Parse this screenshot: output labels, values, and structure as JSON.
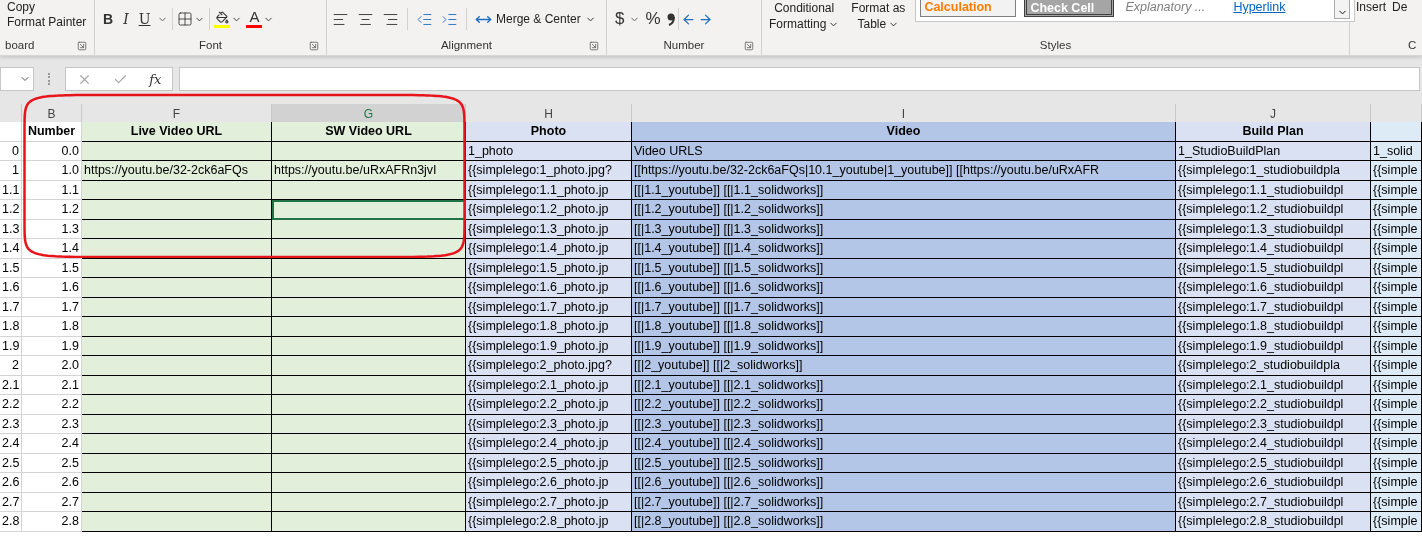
{
  "ribbon": {
    "clipboard": {
      "label": "board",
      "buttons": [
        "Copy",
        "Format Painter"
      ]
    },
    "font": {
      "label": "Font",
      "buttons": [
        {
          "kind": "bold",
          "text": "B"
        },
        {
          "kind": "italic",
          "text": "I"
        },
        {
          "kind": "underline",
          "text": "U"
        }
      ],
      "color_letter": "A"
    },
    "alignment": {
      "label": "Alignment",
      "merge_button": "Merge & Center"
    },
    "number": {
      "label": "Number",
      "symbols": [
        "$",
        "%"
      ]
    },
    "styles": {
      "label": "Styles",
      "buttons": [
        [
          "Conditional",
          "Formatting"
        ],
        [
          "Format as",
          "Table"
        ]
      ],
      "gallery": [
        {
          "kind": "calculation",
          "label": "Calculation"
        },
        {
          "kind": "check",
          "label": "Check Cell"
        },
        {
          "kind": "explanatory",
          "label": "Explanatory ..."
        },
        {
          "kind": "hyperlink",
          "label": "Hyperlink"
        }
      ]
    },
    "cells": {
      "label": "C",
      "buttons": [
        "Insert",
        "De"
      ]
    }
  },
  "formula_bar": {
    "fx": "fx"
  },
  "sheet": {
    "columns": [
      {
        "kind": "index",
        "color": "#ffffff",
        "selected": false
      },
      {
        "kind": "number",
        "letter": "B",
        "header": "Number",
        "color": "#ffffff",
        "selected": false
      },
      {
        "kind": "text",
        "letter": "F",
        "header": "Live Video URL",
        "color": "#e2efda",
        "selected": false
      },
      {
        "kind": "text",
        "letter": "G",
        "header": "SW Video URL",
        "color": "#e2efda",
        "selected": true
      },
      {
        "kind": "text",
        "letter": "H",
        "header": "Photo",
        "color": "#d9e1f2",
        "selected": false
      },
      {
        "kind": "text",
        "letter": "I",
        "header": "Video",
        "color": "#b4c6e7",
        "selected": false
      },
      {
        "kind": "text",
        "letter": "J",
        "header": "Build Plan",
        "color": "#d9e1f2",
        "selected": false
      },
      {
        "kind": "text",
        "color": "#ddebf7",
        "selected": false
      }
    ],
    "rows": [
      {
        "selected": false,
        "cells": [
          "0",
          "0.0",
          "",
          "",
          "1_photo",
          "Video URLS",
          "1_StudioBuildPlan",
          "1_solid"
        ]
      },
      {
        "selected": false,
        "cells": [
          "1",
          "1.0",
          "https://youtu.be/32-2ck6aFQs",
          "https://youtu.be/uRxAFRn3jvI",
          "{{simplelego:1_photo.jpg?",
          "[[https://youtu.be/32-2ck6aFQs|10.1_youtube|1_youtube]] [[https://youtu.be/uRxAFR",
          "{{simplelego:1_studiobuildpla",
          "{{simple"
        ]
      },
      {
        "selected": false,
        "cells": [
          "1.1",
          "1.1",
          "",
          "",
          "{{simplelego:1.1_photo.jp",
          "[[|1.1_youtube]] [[|1.1_solidworks]]",
          "{{simplelego:1.1_studiobuildpl",
          "{{simple"
        ]
      },
      {
        "selected": true,
        "cells": [
          "1.2",
          "1.2",
          "",
          "",
          "{{simplelego:1.2_photo.jp",
          "[[|1.2_youtube]] [[|1.2_solidworks]]",
          "{{simplelego:1.2_studiobuildpl",
          "{{simple"
        ]
      },
      {
        "selected": false,
        "cells": [
          "1.3",
          "1.3",
          "",
          "",
          "{{simplelego:1.3_photo.jp",
          "[[|1.3_youtube]] [[|1.3_solidworks]]",
          "{{simplelego:1.3_studiobuildpl",
          "{{simple"
        ]
      },
      {
        "selected": false,
        "cells": [
          "1.4",
          "1.4",
          "",
          "",
          "{{simplelego:1.4_photo.jp",
          "[[|1.4_youtube]] [[|1.4_solidworks]]",
          "{{simplelego:1.4_studiobuildpl",
          "{{simple"
        ]
      },
      {
        "selected": false,
        "cells": [
          "1.5",
          "1.5",
          "",
          "",
          "{{simplelego:1.5_photo.jp",
          "[[|1.5_youtube]] [[|1.5_solidworks]]",
          "{{simplelego:1.5_studiobuildpl",
          "{{simple"
        ]
      },
      {
        "selected": false,
        "cells": [
          "1.6",
          "1.6",
          "",
          "",
          "{{simplelego:1.6_photo.jp",
          "[[|1.6_youtube]] [[|1.6_solidworks]]",
          "{{simplelego:1.6_studiobuildpl",
          "{{simple"
        ]
      },
      {
        "selected": false,
        "cells": [
          "1.7",
          "1.7",
          "",
          "",
          "{{simplelego:1.7_photo.jp",
          "[[|1.7_youtube]] [[|1.7_solidworks]]",
          "{{simplelego:1.7_studiobuildpl",
          "{{simple"
        ]
      },
      {
        "selected": false,
        "cells": [
          "1.8",
          "1.8",
          "",
          "",
          "{{simplelego:1.8_photo.jp",
          "[[|1.8_youtube]] [[|1.8_solidworks]]",
          "{{simplelego:1.8_studiobuildpl",
          "{{simple"
        ]
      },
      {
        "selected": false,
        "cells": [
          "1.9",
          "1.9",
          "",
          "",
          "{{simplelego:1.9_photo.jp",
          "[[|1.9_youtube]] [[|1.9_solidworks]]",
          "{{simplelego:1.9_studiobuildpl",
          "{{simple"
        ]
      },
      {
        "selected": false,
        "cells": [
          "2",
          "2.0",
          "",
          "",
          "{{simplelego:2_photo.jpg?",
          "[[|2_youtube]] [[|2_solidworks]]",
          "{{simplelego:2_studiobuildpla",
          "{{simple"
        ]
      },
      {
        "selected": false,
        "cells": [
          "2.1",
          "2.1",
          "",
          "",
          "{{simplelego:2.1_photo.jp",
          "[[|2.1_youtube]] [[|2.1_solidworks]]",
          "{{simplelego:2.1_studiobuildpl",
          "{{simple"
        ]
      },
      {
        "selected": false,
        "cells": [
          "2.2",
          "2.2",
          "",
          "",
          "{{simplelego:2.2_photo.jp",
          "[[|2.2_youtube]] [[|2.2_solidworks]]",
          "{{simplelego:2.2_studiobuildpl",
          "{{simple"
        ]
      },
      {
        "selected": false,
        "cells": [
          "2.3",
          "2.3",
          "",
          "",
          "{{simplelego:2.3_photo.jp",
          "[[|2.3_youtube]] [[|2.3_solidworks]]",
          "{{simplelego:2.3_studiobuildpl",
          "{{simple"
        ]
      },
      {
        "selected": false,
        "cells": [
          "2.4",
          "2.4",
          "",
          "",
          "{{simplelego:2.4_photo.jp",
          "[[|2.4_youtube]] [[|2.4_solidworks]]",
          "{{simplelego:2.4_studiobuildpl",
          "{{simple"
        ]
      },
      {
        "selected": false,
        "cells": [
          "2.5",
          "2.5",
          "",
          "",
          "{{simplelego:2.5_photo.jp",
          "[[|2.5_youtube]] [[|2.5_solidworks]]",
          "{{simplelego:2.5_studiobuildpl",
          "{{simple"
        ]
      },
      {
        "selected": false,
        "cells": [
          "2.6",
          "2.6",
          "",
          "",
          "{{simplelego:2.6_photo.jp",
          "[[|2.6_youtube]] [[|2.6_solidworks]]",
          "{{simplelego:2.6_studiobuildpl",
          "{{simple"
        ]
      },
      {
        "selected": false,
        "cells": [
          "2.7",
          "2.7",
          "",
          "",
          "{{simplelego:2.7_photo.jp",
          "[[|2.7_youtube]] [[|2.7_solidworks]]",
          "{{simplelego:2.7_studiobuildpl",
          "{{simple"
        ]
      },
      {
        "selected": false,
        "cells": [
          "2.8",
          "2.8",
          "",
          "",
          "{{simplelego:2.8_photo.jp",
          "[[|2.8_youtube]] [[|2.8_solidworks]]",
          "{{simplelego:2.8_studiobuildpl",
          "{{simple"
        ]
      }
    ]
  }
}
